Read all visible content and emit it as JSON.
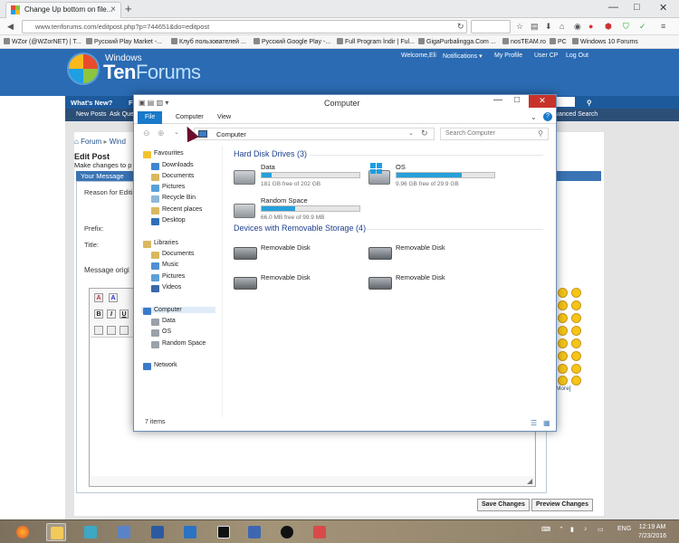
{
  "browser": {
    "tab_title": "Change Up bottom on file...",
    "tab_close": "×",
    "new_tab": "+",
    "min": "—",
    "max": "□",
    "close": "✕",
    "url": "www.tenforums.com/editpost.php?p=744651&do=editpost",
    "bookmarks": [
      "WZor (@WZorNET) | T...",
      "Русский Play Market -...",
      "Клуб пользователей ...",
      "Русский Google Play -...",
      "Full Program İndir | Ful...",
      "GigaPurbalingga.Com ...",
      "nosTEAM.ro",
      "PC",
      "Windows 10 Forums"
    ]
  },
  "site": {
    "logo_small": "Windows",
    "logo_ten": "Ten",
    "logo_forums": "Forums",
    "welcome": "Welcome,",
    "user": "Eli",
    "links": [
      "Notifications ▾",
      "My Profile",
      "User CP",
      "Log Out"
    ],
    "nav1": [
      "What's New?",
      "Fo"
    ],
    "nav2": [
      "New Posts",
      "Ask Ques"
    ],
    "advanced_search": "Advanced Search",
    "crumb_forum": "Forum",
    "crumb_next": "Wind",
    "edit_title": "Edit Post",
    "edit_sub": "Make changes to p",
    "your_message": "Your Message",
    "reason_label": "Reason for Editi",
    "prefix_label": "Prefix:",
    "title_label": "Title:",
    "message_label": "Message origi",
    "more": "More]",
    "save_changes": "Save Changes",
    "preview_changes": "Preview Changes"
  },
  "explorer": {
    "title": "Computer",
    "min": "—",
    "max": "□",
    "close": "✕",
    "help": "?",
    "ribbon_tabs": [
      "File",
      "Computer",
      "View"
    ],
    "address": "Computer",
    "search_placeholder": "Search Computer",
    "nav": {
      "favourites": "Favourites",
      "fav_items": [
        "Downloads",
        "Documents",
        "Pictures",
        "Recycle Bin",
        "Recent places",
        "Desktop"
      ],
      "libraries": "Libraries",
      "lib_items": [
        "Documents",
        "Music",
        "Pictures",
        "Videos"
      ],
      "computer": "Computer",
      "comp_items": [
        "Data",
        "OS",
        "Random Space"
      ],
      "network": "Network"
    },
    "hard_drives_header": "Hard Disk Drives (3)",
    "drives": [
      {
        "name": "Data",
        "free": "181 GB free of 202 GB",
        "used_fraction": 0.104
      },
      {
        "name": "OS",
        "free": "9.96 GB free of 29.9 GB",
        "used_fraction": 0.667
      },
      {
        "name": "Random Space",
        "free": "66.0 MB free of 99.9 MB",
        "used_fraction": 0.339
      }
    ],
    "removable_header": "Devices with Removable Storage (4)",
    "removable": [
      "Removable Disk",
      "Removable Disk",
      "Removable Disk",
      "Removable Disk"
    ],
    "status": "7 items"
  },
  "taskbar": {
    "lang": "ENG",
    "time": "12:19 AM",
    "date": "7/23/2016"
  },
  "colors": {
    "accent": "#2b6bb3",
    "drive_bar": "#26a0da"
  }
}
